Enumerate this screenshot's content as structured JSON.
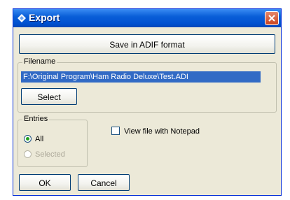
{
  "window": {
    "title": "Export",
    "title_icon": "diamond-icon",
    "close_icon": "close-icon"
  },
  "save_button": {
    "label": "Save in ADIF format"
  },
  "filename_group": {
    "label": "Filename",
    "value": "F:\\Original Program\\Ham Radio Deluxe\\Test.ADI",
    "select_label": "Select"
  },
  "entries_group": {
    "label": "Entries",
    "options": [
      {
        "label": "All",
        "selected": true,
        "enabled": true
      },
      {
        "label": "Selected",
        "selected": false,
        "enabled": false
      }
    ]
  },
  "view_notepad": {
    "label": "View file with Notepad",
    "checked": false
  },
  "footer": {
    "ok_label": "OK",
    "cancel_label": "Cancel"
  },
  "colors": {
    "titlebar": "#0a5fd8",
    "selection": "#316ac5",
    "close": "#c8431f"
  }
}
